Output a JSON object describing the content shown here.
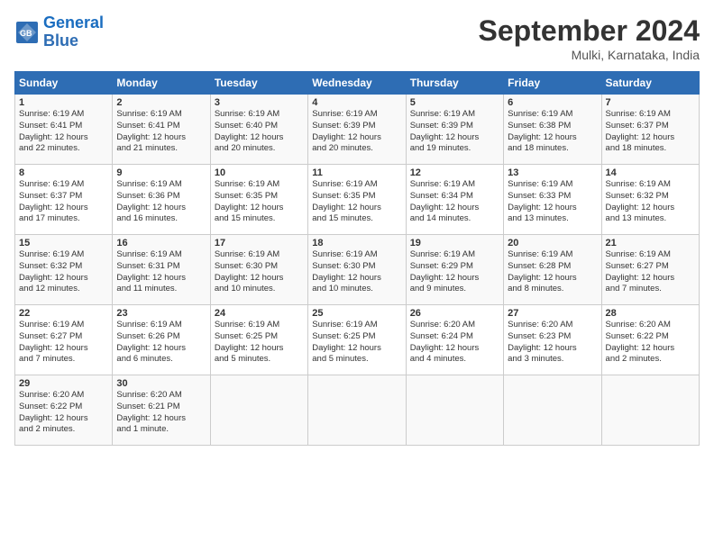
{
  "header": {
    "logo_line1": "General",
    "logo_line2": "Blue",
    "month_title": "September 2024",
    "location": "Mulki, Karnataka, India"
  },
  "days_of_week": [
    "Sunday",
    "Monday",
    "Tuesday",
    "Wednesday",
    "Thursday",
    "Friday",
    "Saturday"
  ],
  "weeks": [
    [
      {
        "day": "1",
        "lines": [
          "Sunrise: 6:19 AM",
          "Sunset: 6:41 PM",
          "Daylight: 12 hours",
          "and 22 minutes."
        ]
      },
      {
        "day": "2",
        "lines": [
          "Sunrise: 6:19 AM",
          "Sunset: 6:41 PM",
          "Daylight: 12 hours",
          "and 21 minutes."
        ]
      },
      {
        "day": "3",
        "lines": [
          "Sunrise: 6:19 AM",
          "Sunset: 6:40 PM",
          "Daylight: 12 hours",
          "and 20 minutes."
        ]
      },
      {
        "day": "4",
        "lines": [
          "Sunrise: 6:19 AM",
          "Sunset: 6:39 PM",
          "Daylight: 12 hours",
          "and 20 minutes."
        ]
      },
      {
        "day": "5",
        "lines": [
          "Sunrise: 6:19 AM",
          "Sunset: 6:39 PM",
          "Daylight: 12 hours",
          "and 19 minutes."
        ]
      },
      {
        "day": "6",
        "lines": [
          "Sunrise: 6:19 AM",
          "Sunset: 6:38 PM",
          "Daylight: 12 hours",
          "and 18 minutes."
        ]
      },
      {
        "day": "7",
        "lines": [
          "Sunrise: 6:19 AM",
          "Sunset: 6:37 PM",
          "Daylight: 12 hours",
          "and 18 minutes."
        ]
      }
    ],
    [
      {
        "day": "8",
        "lines": [
          "Sunrise: 6:19 AM",
          "Sunset: 6:37 PM",
          "Daylight: 12 hours",
          "and 17 minutes."
        ]
      },
      {
        "day": "9",
        "lines": [
          "Sunrise: 6:19 AM",
          "Sunset: 6:36 PM",
          "Daylight: 12 hours",
          "and 16 minutes."
        ]
      },
      {
        "day": "10",
        "lines": [
          "Sunrise: 6:19 AM",
          "Sunset: 6:35 PM",
          "Daylight: 12 hours",
          "and 15 minutes."
        ]
      },
      {
        "day": "11",
        "lines": [
          "Sunrise: 6:19 AM",
          "Sunset: 6:35 PM",
          "Daylight: 12 hours",
          "and 15 minutes."
        ]
      },
      {
        "day": "12",
        "lines": [
          "Sunrise: 6:19 AM",
          "Sunset: 6:34 PM",
          "Daylight: 12 hours",
          "and 14 minutes."
        ]
      },
      {
        "day": "13",
        "lines": [
          "Sunrise: 6:19 AM",
          "Sunset: 6:33 PM",
          "Daylight: 12 hours",
          "and 13 minutes."
        ]
      },
      {
        "day": "14",
        "lines": [
          "Sunrise: 6:19 AM",
          "Sunset: 6:32 PM",
          "Daylight: 12 hours",
          "and 13 minutes."
        ]
      }
    ],
    [
      {
        "day": "15",
        "lines": [
          "Sunrise: 6:19 AM",
          "Sunset: 6:32 PM",
          "Daylight: 12 hours",
          "and 12 minutes."
        ]
      },
      {
        "day": "16",
        "lines": [
          "Sunrise: 6:19 AM",
          "Sunset: 6:31 PM",
          "Daylight: 12 hours",
          "and 11 minutes."
        ]
      },
      {
        "day": "17",
        "lines": [
          "Sunrise: 6:19 AM",
          "Sunset: 6:30 PM",
          "Daylight: 12 hours",
          "and 10 minutes."
        ]
      },
      {
        "day": "18",
        "lines": [
          "Sunrise: 6:19 AM",
          "Sunset: 6:30 PM",
          "Daylight: 12 hours",
          "and 10 minutes."
        ]
      },
      {
        "day": "19",
        "lines": [
          "Sunrise: 6:19 AM",
          "Sunset: 6:29 PM",
          "Daylight: 12 hours",
          "and 9 minutes."
        ]
      },
      {
        "day": "20",
        "lines": [
          "Sunrise: 6:19 AM",
          "Sunset: 6:28 PM",
          "Daylight: 12 hours",
          "and 8 minutes."
        ]
      },
      {
        "day": "21",
        "lines": [
          "Sunrise: 6:19 AM",
          "Sunset: 6:27 PM",
          "Daylight: 12 hours",
          "and 7 minutes."
        ]
      }
    ],
    [
      {
        "day": "22",
        "lines": [
          "Sunrise: 6:19 AM",
          "Sunset: 6:27 PM",
          "Daylight: 12 hours",
          "and 7 minutes."
        ]
      },
      {
        "day": "23",
        "lines": [
          "Sunrise: 6:19 AM",
          "Sunset: 6:26 PM",
          "Daylight: 12 hours",
          "and 6 minutes."
        ]
      },
      {
        "day": "24",
        "lines": [
          "Sunrise: 6:19 AM",
          "Sunset: 6:25 PM",
          "Daylight: 12 hours",
          "and 5 minutes."
        ]
      },
      {
        "day": "25",
        "lines": [
          "Sunrise: 6:19 AM",
          "Sunset: 6:25 PM",
          "Daylight: 12 hours",
          "and 5 minutes."
        ]
      },
      {
        "day": "26",
        "lines": [
          "Sunrise: 6:20 AM",
          "Sunset: 6:24 PM",
          "Daylight: 12 hours",
          "and 4 minutes."
        ]
      },
      {
        "day": "27",
        "lines": [
          "Sunrise: 6:20 AM",
          "Sunset: 6:23 PM",
          "Daylight: 12 hours",
          "and 3 minutes."
        ]
      },
      {
        "day": "28",
        "lines": [
          "Sunrise: 6:20 AM",
          "Sunset: 6:22 PM",
          "Daylight: 12 hours",
          "and 2 minutes."
        ]
      }
    ],
    [
      {
        "day": "29",
        "lines": [
          "Sunrise: 6:20 AM",
          "Sunset: 6:22 PM",
          "Daylight: 12 hours",
          "and 2 minutes."
        ]
      },
      {
        "day": "30",
        "lines": [
          "Sunrise: 6:20 AM",
          "Sunset: 6:21 PM",
          "Daylight: 12 hours",
          "and 1 minute."
        ]
      },
      {
        "day": "",
        "lines": []
      },
      {
        "day": "",
        "lines": []
      },
      {
        "day": "",
        "lines": []
      },
      {
        "day": "",
        "lines": []
      },
      {
        "day": "",
        "lines": []
      }
    ]
  ]
}
